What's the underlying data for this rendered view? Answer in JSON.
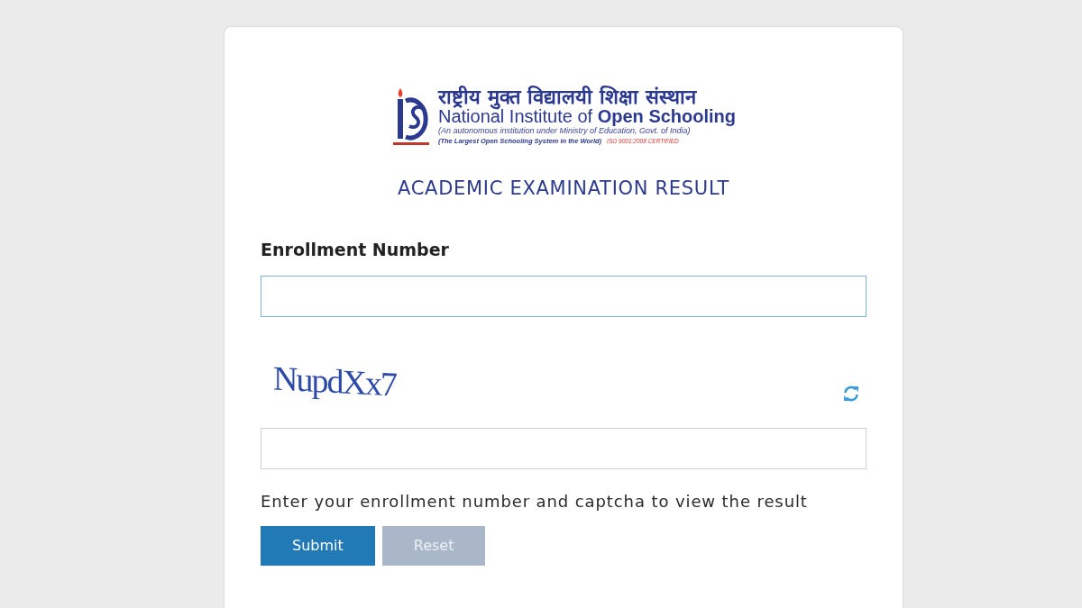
{
  "logo": {
    "hindi_name": "राष्ट्रीय मुक्त विद्यालयी शिक्षा संस्थान",
    "english_name": "National Institute of **Open Schooling**",
    "subtitle": "(An autonomous institution under Ministry of Education, Govt. of India)",
    "tagline": "(The Largest Open Schooling System in the World)",
    "certification": "ISO 9001:2008 CERTIFIED"
  },
  "title": "ACADEMIC EXAMINATION RESULT",
  "enrollment": {
    "label": "Enrollment Number",
    "focused": true
  },
  "captcha": {
    "text": "NupdXx7",
    "focused": false
  },
  "help_text": "Enter your enrollment number and captcha to view the result",
  "buttons": [
    {
      "label": "Submit",
      "kind": "primary"
    },
    {
      "label": "Reset",
      "kind": "secondary"
    }
  ]
}
